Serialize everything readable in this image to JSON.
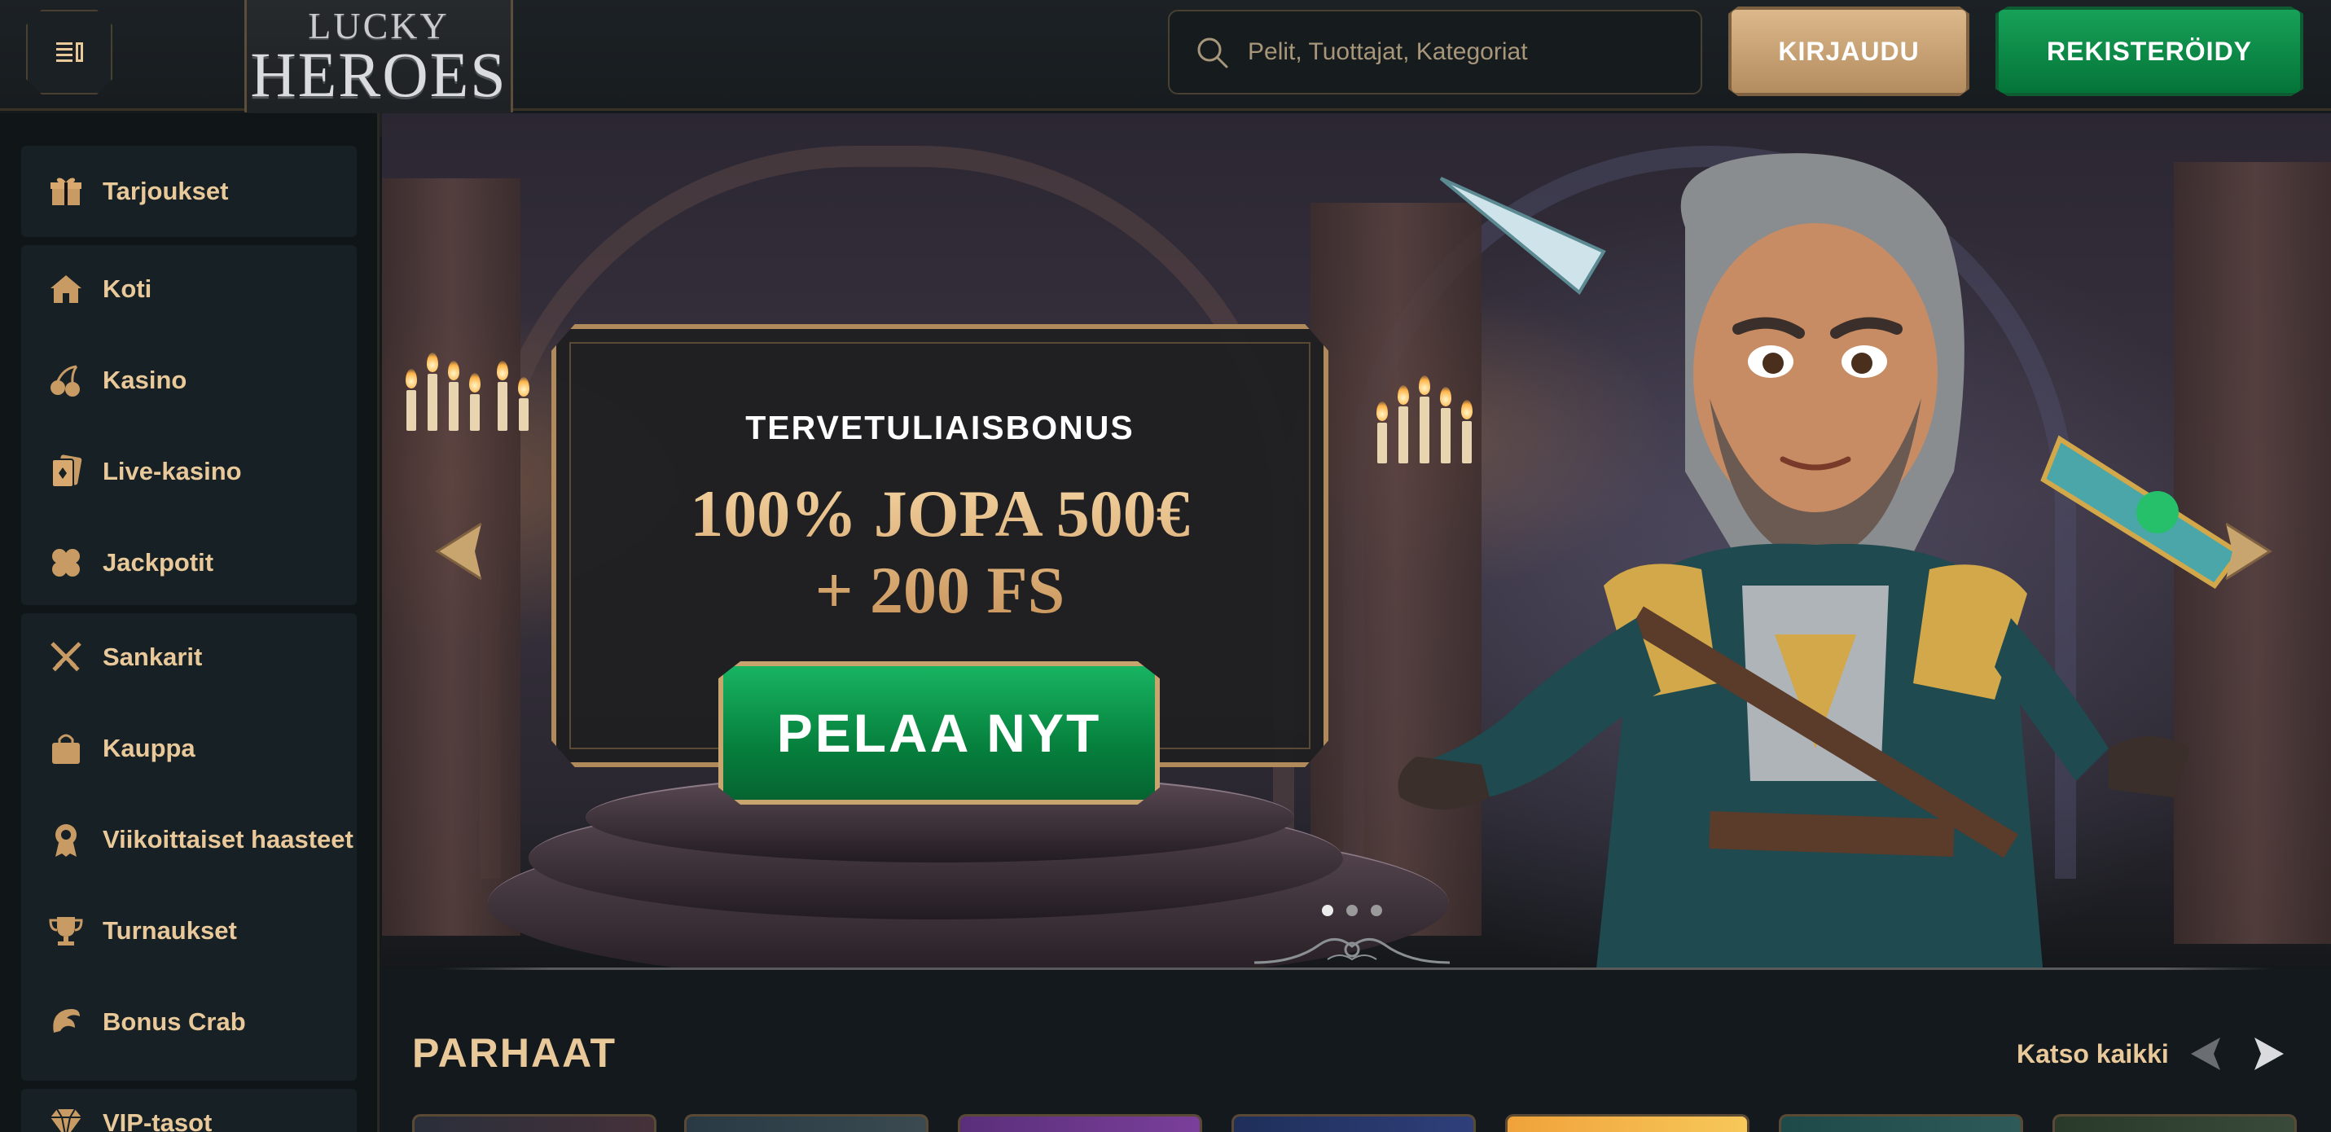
{
  "header": {
    "logo_top": "LUCKY",
    "logo_bottom": "HEROES",
    "search_placeholder": "Pelit, Tuottajat, Kategoriat",
    "login_label": "KIRJAUDU",
    "register_label": "REKISTERÖIDY"
  },
  "sidebar": {
    "items": [
      {
        "label": "Tarjoukset",
        "icon": "gift-icon"
      },
      {
        "label": "Koti",
        "icon": "home-icon"
      },
      {
        "label": "Kasino",
        "icon": "cherries-icon"
      },
      {
        "label": "Live-kasino",
        "icon": "playing-card-icon"
      },
      {
        "label": "Jackpotit",
        "icon": "clover-icon"
      },
      {
        "label": "Sankarit",
        "icon": "crossed-swords-icon"
      },
      {
        "label": "Kauppa",
        "icon": "shopping-bag-icon"
      },
      {
        "label": "Viikoittaiset haasteet",
        "icon": "medal-icon"
      },
      {
        "label": "Turnaukset",
        "icon": "trophy-icon"
      },
      {
        "label": "Bonus Crab",
        "icon": "crab-claw-icon"
      },
      {
        "label": "VIP-tasot",
        "icon": "diamond-icon"
      }
    ]
  },
  "hero": {
    "subtitle": "TERVETULIAISBONUS",
    "title_line1": "100% JOPA 500€",
    "title_line2": "+ 200 FS",
    "cta_label": "PELAA NYT",
    "slide_count": 3,
    "active_slide": 1
  },
  "section": {
    "title": "PARHAAT",
    "see_all_label": "Katso kaikki"
  },
  "colors": {
    "accent_gold": "#e9c99a",
    "cta_green": "#06803d",
    "background": "#13191d"
  }
}
